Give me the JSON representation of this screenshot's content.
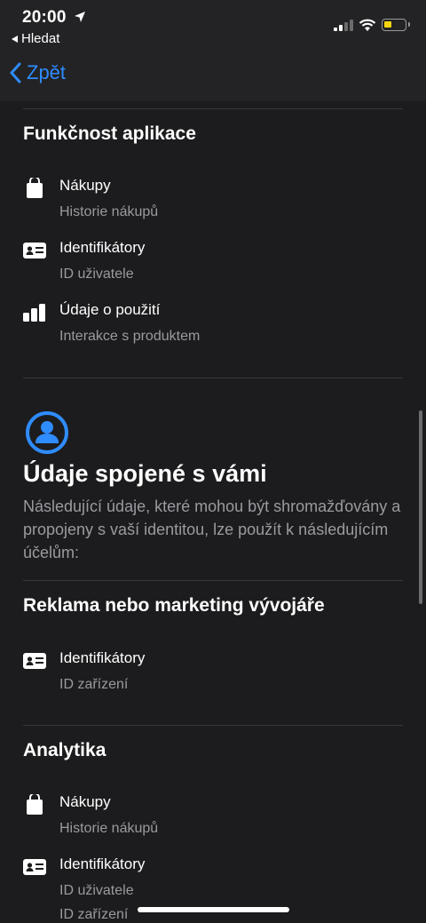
{
  "status_bar": {
    "time": "20:00",
    "back_app": "Hledat"
  },
  "nav": {
    "back_label": "Zpět"
  },
  "sections": {
    "functionality": {
      "title": "Funkčnost aplikace",
      "items": [
        {
          "label": "Nákupy",
          "sub": "Historie nákupů",
          "icon": "bag-icon"
        },
        {
          "label": "Identifikátory",
          "sub": "ID uživatele",
          "icon": "id-card-icon"
        },
        {
          "label": "Údaje o použití",
          "sub": "Interakce s produktem",
          "icon": "bar-chart-icon"
        }
      ]
    },
    "linked": {
      "title": "Údaje spojené s vámi",
      "description": "Následující údaje, které mohou být shromažďovány a propojeny s vaší identitou, lze použít k následujícím účelům:"
    },
    "advertising": {
      "title": "Reklama nebo marketing vývojáře",
      "items": [
        {
          "label": "Identifikátory",
          "sub": "ID zařízení",
          "icon": "id-card-icon"
        }
      ]
    },
    "analytics": {
      "title": "Analytika",
      "items": [
        {
          "label": "Nákupy",
          "sub": "Historie nákupů",
          "icon": "bag-icon"
        },
        {
          "label": "Identifikátory",
          "sub": "ID uživatele",
          "sub2": "ID zařízení",
          "icon": "id-card-icon"
        }
      ]
    }
  },
  "colors": {
    "background": "#1c1c1e",
    "accent": "#2f8cff",
    "secondary_text": "#9a9aa0",
    "battery": "#f5d40f"
  }
}
